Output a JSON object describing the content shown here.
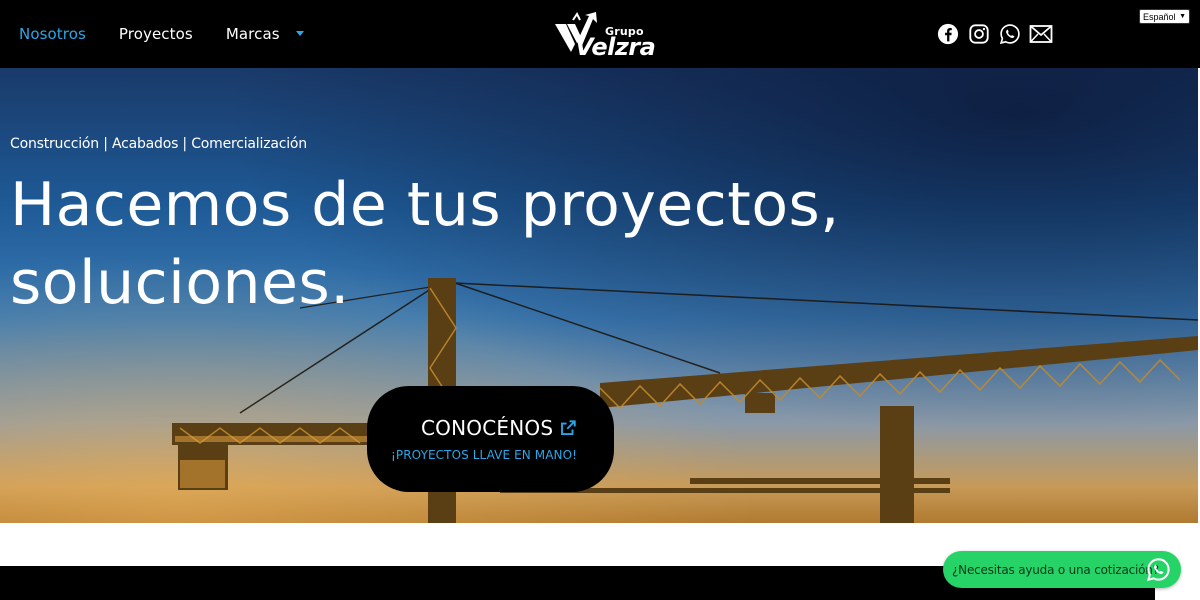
{
  "nav": {
    "items": [
      {
        "label": "Nosotros",
        "active": true
      },
      {
        "label": "Proyectos",
        "active": false
      },
      {
        "label": "Marcas",
        "active": false
      }
    ]
  },
  "logo": {
    "small": "Grupo",
    "big": "Velzra"
  },
  "social": [
    "facebook-icon",
    "instagram-icon",
    "whatsapp-icon",
    "mail-icon"
  ],
  "language": {
    "selected": "Español"
  },
  "hero": {
    "subtitle": "Construcción | Acabados | Comercialización",
    "title": "Hacemos de tus proyectos, soluciones.",
    "cta_label": "CONOCÉNOS",
    "cta_sub": "¡PROYECTOS LLAVE EN MANO!"
  },
  "whatsapp_float": {
    "label": "¿Necesitas ayuda o una cotización?"
  },
  "colors": {
    "accent": "#2aa7e8",
    "whatsapp": "#25d366",
    "nav_bg": "#000000"
  }
}
